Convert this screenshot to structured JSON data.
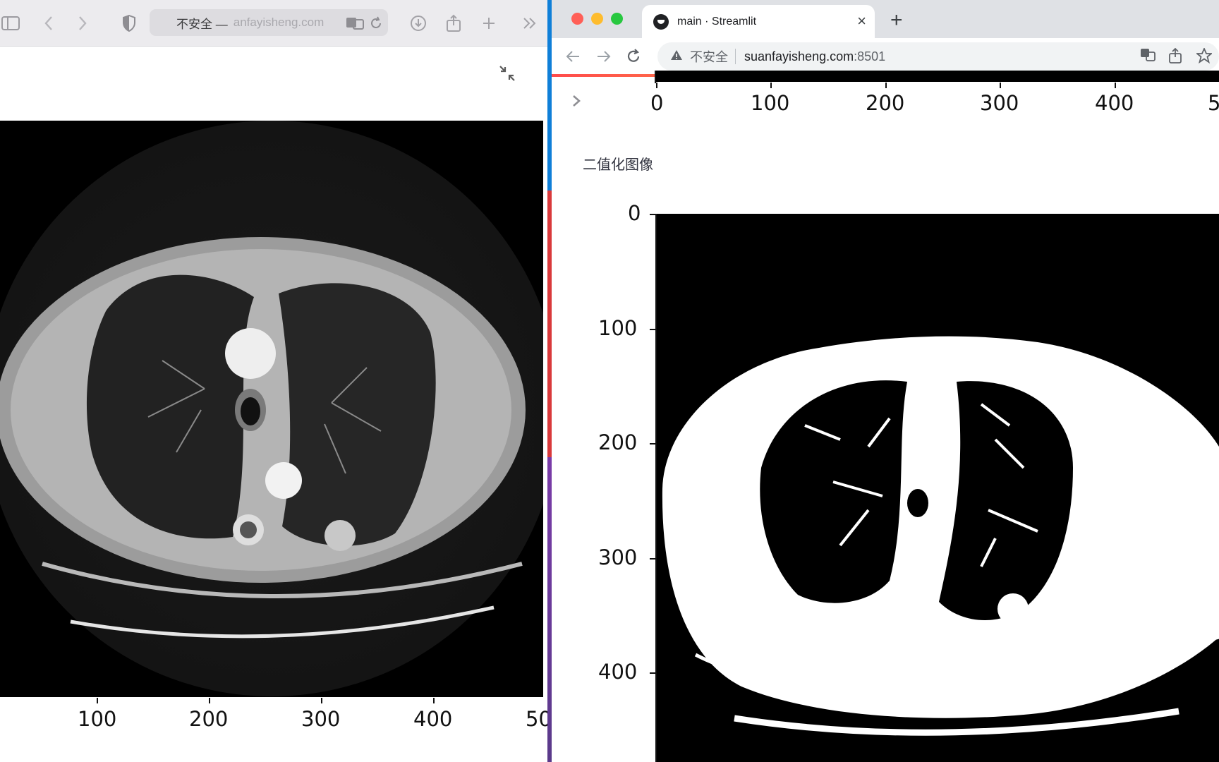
{
  "left_browser": {
    "address_prefix": "不安全 —",
    "address_url": "anfayisheng.com",
    "icons": [
      "sidebar-icon",
      "back-icon",
      "forward-icon",
      "shield-icon",
      "translate-icon",
      "reload-icon",
      "download-icon",
      "share-icon",
      "new-tab-icon",
      "more-icon",
      "collapse-icon"
    ],
    "plot": {
      "x_ticks": [
        "100",
        "200",
        "300",
        "400",
        "50"
      ]
    }
  },
  "right_browser": {
    "tab_title": "main · Streamlit",
    "tab_close": "×",
    "new_tab": "+",
    "omnibox_insecure": "不安全",
    "omnibox_host": "suanfayisheng.com",
    "omnibox_port": ":8501",
    "icons": [
      "back-icon",
      "forward-icon",
      "reload-icon",
      "warning-icon",
      "translate-icon",
      "share-icon",
      "star-icon",
      "sidebar-expand-icon"
    ],
    "top_plot": {
      "x_ticks": [
        "0",
        "100",
        "200",
        "300",
        "400",
        "5"
      ]
    },
    "section_label": "二值化图像",
    "binary_plot": {
      "y_ticks": [
        "0",
        "100",
        "200",
        "300",
        "400"
      ]
    }
  },
  "colors": {
    "streamlit_red": "#ff4b4b",
    "chrome_tabstrip": "#dfe1e5",
    "safari_toolbar": "#ecebee"
  }
}
